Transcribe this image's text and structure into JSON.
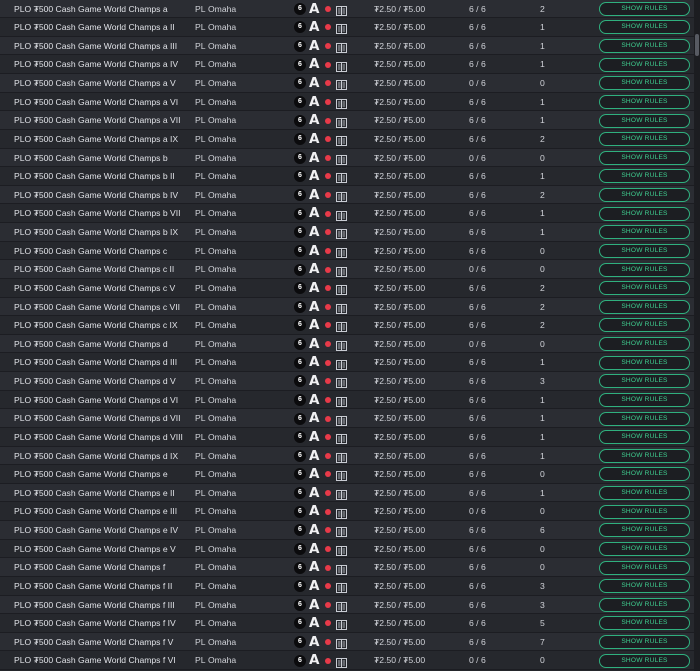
{
  "columns": {
    "limit": "PL",
    "game": "Omaha",
    "seat_badge": "6",
    "letter": "A",
    "stakes": "₮2.50 / ₮5.00",
    "button_label": "SHOW RULES"
  },
  "icons": {
    "dot": "red-status-dot",
    "lobby": "table-lobby-icon"
  },
  "colors": {
    "accent": "#3fcf90",
    "dot": "#e83a49"
  },
  "rows": [
    {
      "name": "PLO ₮500 Cash Game World Champs a",
      "seats": "6 / 6",
      "waiting": "2"
    },
    {
      "name": "PLO ₮500 Cash Game World Champs a II",
      "seats": "6 / 6",
      "waiting": "1"
    },
    {
      "name": "PLO ₮500 Cash Game World Champs a III",
      "seats": "6 / 6",
      "waiting": "1"
    },
    {
      "name": "PLO ₮500 Cash Game World Champs a IV",
      "seats": "6 / 6",
      "waiting": "1"
    },
    {
      "name": "PLO ₮500 Cash Game World Champs a V",
      "seats": "0 / 6",
      "waiting": "0"
    },
    {
      "name": "PLO ₮500 Cash Game World Champs a VI",
      "seats": "6 / 6",
      "waiting": "1"
    },
    {
      "name": "PLO ₮500 Cash Game World Champs a VII",
      "seats": "6 / 6",
      "waiting": "1"
    },
    {
      "name": "PLO ₮500 Cash Game World Champs a IX",
      "seats": "6 / 6",
      "waiting": "2"
    },
    {
      "name": "PLO ₮500 Cash Game World Champs b",
      "seats": "0 / 6",
      "waiting": "0"
    },
    {
      "name": "PLO ₮500 Cash Game World Champs b II",
      "seats": "6 / 6",
      "waiting": "1"
    },
    {
      "name": "PLO ₮500 Cash Game World Champs b IV",
      "seats": "6 / 6",
      "waiting": "2"
    },
    {
      "name": "PLO ₮500 Cash Game World Champs b VII",
      "seats": "6 / 6",
      "waiting": "1"
    },
    {
      "name": "PLO ₮500 Cash Game World Champs b IX",
      "seats": "6 / 6",
      "waiting": "1"
    },
    {
      "name": "PLO ₮500 Cash Game World Champs c",
      "seats": "6 / 6",
      "waiting": "0"
    },
    {
      "name": "PLO ₮500 Cash Game World Champs c II",
      "seats": "0 / 6",
      "waiting": "0"
    },
    {
      "name": "PLO ₮500 Cash Game World Champs c V",
      "seats": "6 / 6",
      "waiting": "2"
    },
    {
      "name": "PLO ₮500 Cash Game World Champs c VII",
      "seats": "6 / 6",
      "waiting": "2"
    },
    {
      "name": "PLO ₮500 Cash Game World Champs c IX",
      "seats": "6 / 6",
      "waiting": "2"
    },
    {
      "name": "PLO ₮500 Cash Game World Champs d",
      "seats": "0 / 6",
      "waiting": "0"
    },
    {
      "name": "PLO ₮500 Cash Game World Champs d III",
      "seats": "6 / 6",
      "waiting": "1"
    },
    {
      "name": "PLO ₮500 Cash Game World Champs d V",
      "seats": "6 / 6",
      "waiting": "3"
    },
    {
      "name": "PLO ₮500 Cash Game World Champs d VI",
      "seats": "6 / 6",
      "waiting": "1"
    },
    {
      "name": "PLO ₮500 Cash Game World Champs d VII",
      "seats": "6 / 6",
      "waiting": "1"
    },
    {
      "name": "PLO ₮500 Cash Game World Champs d VIII",
      "seats": "6 / 6",
      "waiting": "1"
    },
    {
      "name": "PLO ₮500 Cash Game World Champs d IX",
      "seats": "6 / 6",
      "waiting": "1"
    },
    {
      "name": "PLO ₮500 Cash Game World Champs e",
      "seats": "6 / 6",
      "waiting": "0"
    },
    {
      "name": "PLO ₮500 Cash Game World Champs e II",
      "seats": "6 / 6",
      "waiting": "1"
    },
    {
      "name": "PLO ₮500 Cash Game World Champs e III",
      "seats": "0 / 6",
      "waiting": "0"
    },
    {
      "name": "PLO ₮500 Cash Game World Champs e IV",
      "seats": "6 / 6",
      "waiting": "6"
    },
    {
      "name": "PLO ₮500 Cash Game World Champs e V",
      "seats": "6 / 6",
      "waiting": "0"
    },
    {
      "name": "PLO ₮500 Cash Game World Champs f",
      "seats": "6 / 6",
      "waiting": "0"
    },
    {
      "name": "PLO ₮500 Cash Game World Champs f II",
      "seats": "6 / 6",
      "waiting": "3"
    },
    {
      "name": "PLO ₮500 Cash Game World Champs f III",
      "seats": "6 / 6",
      "waiting": "3"
    },
    {
      "name": "PLO ₮500 Cash Game World Champs f IV",
      "seats": "6 / 6",
      "waiting": "5"
    },
    {
      "name": "PLO ₮500 Cash Game World Champs f V",
      "seats": "6 / 6",
      "waiting": "7"
    },
    {
      "name": "PLO ₮500 Cash Game World Champs f VI",
      "seats": "0 / 6",
      "waiting": "0"
    }
  ]
}
